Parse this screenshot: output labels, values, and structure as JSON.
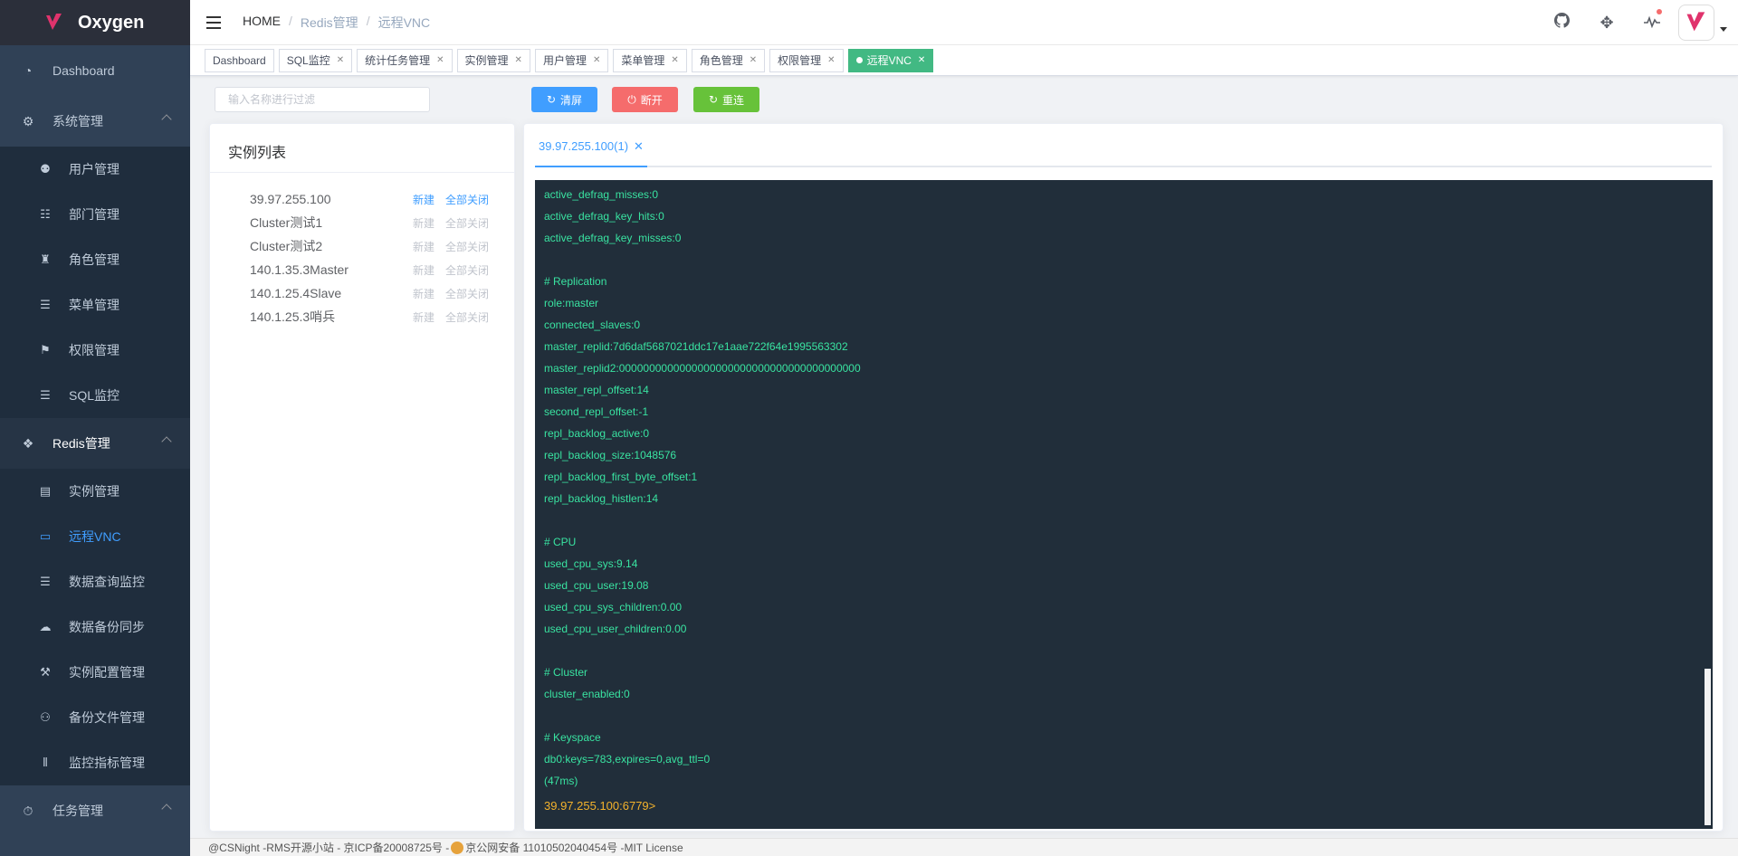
{
  "app": {
    "name": "Oxygen"
  },
  "sidebar": {
    "items": [
      {
        "label": "Dashboard",
        "icon": "dashboard-icon"
      },
      {
        "label": "系统管理",
        "icon": "gears-icon",
        "children": [
          {
            "label": "用户管理",
            "icon": "user-gear-icon"
          },
          {
            "label": "部门管理",
            "icon": "sitemap-icon"
          },
          {
            "label": "角色管理",
            "icon": "role-icon"
          },
          {
            "label": "菜单管理",
            "icon": "list-icon"
          },
          {
            "label": "权限管理",
            "icon": "permission-icon"
          },
          {
            "label": "SQL监控",
            "icon": "database-icon"
          }
        ]
      },
      {
        "label": "Redis管理",
        "icon": "redis-icon",
        "children": [
          {
            "label": "实例管理",
            "icon": "server-icon"
          },
          {
            "label": "远程VNC",
            "icon": "monitor-icon",
            "active": true
          },
          {
            "label": "数据查询监控",
            "icon": "list-check-icon"
          },
          {
            "label": "数据备份同步",
            "icon": "cloud-download-icon"
          },
          {
            "label": "实例配置管理",
            "icon": "wrench-icon"
          },
          {
            "label": "备份文件管理",
            "icon": "files-icon"
          },
          {
            "label": "监控指标管理",
            "icon": "sliders-icon"
          }
        ]
      },
      {
        "label": "任务管理",
        "icon": "stopwatch-icon"
      }
    ]
  },
  "breadcrumb": [
    "HOME",
    "Redis管理",
    "远程VNC"
  ],
  "tags": [
    {
      "label": "Dashboard",
      "closable": false
    },
    {
      "label": "SQL监控",
      "closable": true
    },
    {
      "label": "统计任务管理",
      "closable": true
    },
    {
      "label": "实例管理",
      "closable": true
    },
    {
      "label": "用户管理",
      "closable": true
    },
    {
      "label": "菜单管理",
      "closable": true
    },
    {
      "label": "角色管理",
      "closable": true
    },
    {
      "label": "权限管理",
      "closable": true
    },
    {
      "label": "远程VNC",
      "closable": true,
      "active": true
    }
  ],
  "filter": {
    "placeholder": "输入名称进行过滤",
    "value": ""
  },
  "buttons": {
    "clear": "清屏",
    "disconnect": "断开",
    "reconnect": "重连"
  },
  "instance_list": {
    "title": "实例列表",
    "new_label": "新建",
    "close_all_label": "全部关闭",
    "items": [
      {
        "name": "39.97.255.100",
        "connected": true
      },
      {
        "name": "Cluster测试1",
        "connected": false
      },
      {
        "name": "Cluster测试2",
        "connected": false
      },
      {
        "name": "140.1.35.3Master",
        "connected": false
      },
      {
        "name": "140.1.25.4Slave",
        "connected": false
      },
      {
        "name": "140.1.25.3哨兵",
        "connected": false
      }
    ]
  },
  "terminal": {
    "tab_label": "39.97.255.100(1)",
    "lines": [
      "active_defrag_misses:0",
      "active_defrag_key_hits:0",
      "active_defrag_key_misses:0",
      "",
      "# Replication",
      "role:master",
      "connected_slaves:0",
      "master_replid:7d6daf5687021ddc17e1aae722f64e1995563302",
      "master_replid2:0000000000000000000000000000000000000000",
      "master_repl_offset:14",
      "second_repl_offset:-1",
      "repl_backlog_active:0",
      "repl_backlog_size:1048576",
      "repl_backlog_first_byte_offset:1",
      "repl_backlog_histlen:14",
      "",
      "# CPU",
      "used_cpu_sys:9.14",
      "used_cpu_user:19.08",
      "used_cpu_sys_children:0.00",
      "used_cpu_user_children:0.00",
      "",
      "# Cluster",
      "cluster_enabled:0",
      "",
      "# Keyspace",
      "db0:keys=783,expires=0,avg_ttl=0",
      "(47ms)"
    ],
    "prompt": "39.97.255.100:6779>"
  },
  "footer": {
    "left": "@CSNight -RMS开源小站 - 京ICP备20008725号 -",
    "right": "京公网安备 11010502040454号 -MIT License"
  },
  "colors": {
    "sidebar_bg": "#304156",
    "active_menu": "#409eff",
    "tag_active": "#42b983",
    "terminal_bg": "#212e3a",
    "terminal_text": "#39e3a1",
    "prompt": "#f3b22c"
  }
}
